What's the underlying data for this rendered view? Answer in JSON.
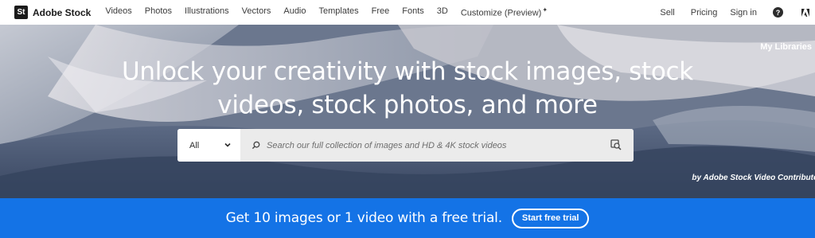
{
  "brand": {
    "logo_mark": "St",
    "name": "Adobe Stock"
  },
  "nav": {
    "items": [
      {
        "label": "Videos"
      },
      {
        "label": "Photos"
      },
      {
        "label": "Illustrations"
      },
      {
        "label": "Vectors"
      },
      {
        "label": "Audio"
      },
      {
        "label": "Templates"
      },
      {
        "label": "Free"
      },
      {
        "label": "Fonts"
      },
      {
        "label": "3D"
      },
      {
        "label": "Customize (Preview)"
      }
    ],
    "sell": "Sell",
    "pricing": "Pricing",
    "sign_in": "Sign in",
    "help_glyph": "?"
  },
  "hero": {
    "my_libraries": "My Libraries",
    "title_line1": "Unlock your creativity with stock images, stock",
    "title_line2": "videos, stock photos, and more",
    "search": {
      "category": "All",
      "placeholder": "Search our full collection of images and HD & 4K stock videos"
    },
    "credit": "by Adobe Stock Video Contributor"
  },
  "promo": {
    "text": "Get 10 images or 1 video with a free trial.",
    "button": "Start free trial"
  },
  "colors": {
    "promo_bg": "#1473e6",
    "hero_tone": "#6f7c93"
  },
  "icons": [
    "sparkle-icon",
    "help-icon",
    "adobe-logo-icon",
    "chevron-down-icon",
    "search-icon",
    "visual-search-icon"
  ]
}
